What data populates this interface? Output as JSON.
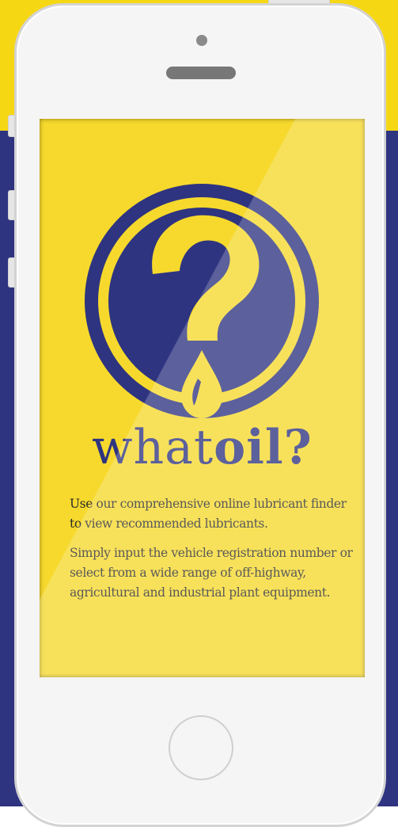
{
  "app": {
    "brand_light": "what",
    "brand_bold": "oil?",
    "paragraph_1": "Use our comprehensive online lubricant finder to view recommended lubricants.",
    "paragraph_2": "Simply input the vehicle registration number or select from a wide range of off-highway, agricultural and industrial plant equipment."
  },
  "icons": {
    "logo": "question-mark-oil-drop-icon",
    "camera": "front-camera",
    "speaker": "earpiece-speaker",
    "home": "home-button"
  },
  "colors": {
    "yellow": "#f6d714",
    "navy": "#2e3480",
    "phone_body": "#f5f5f5"
  }
}
